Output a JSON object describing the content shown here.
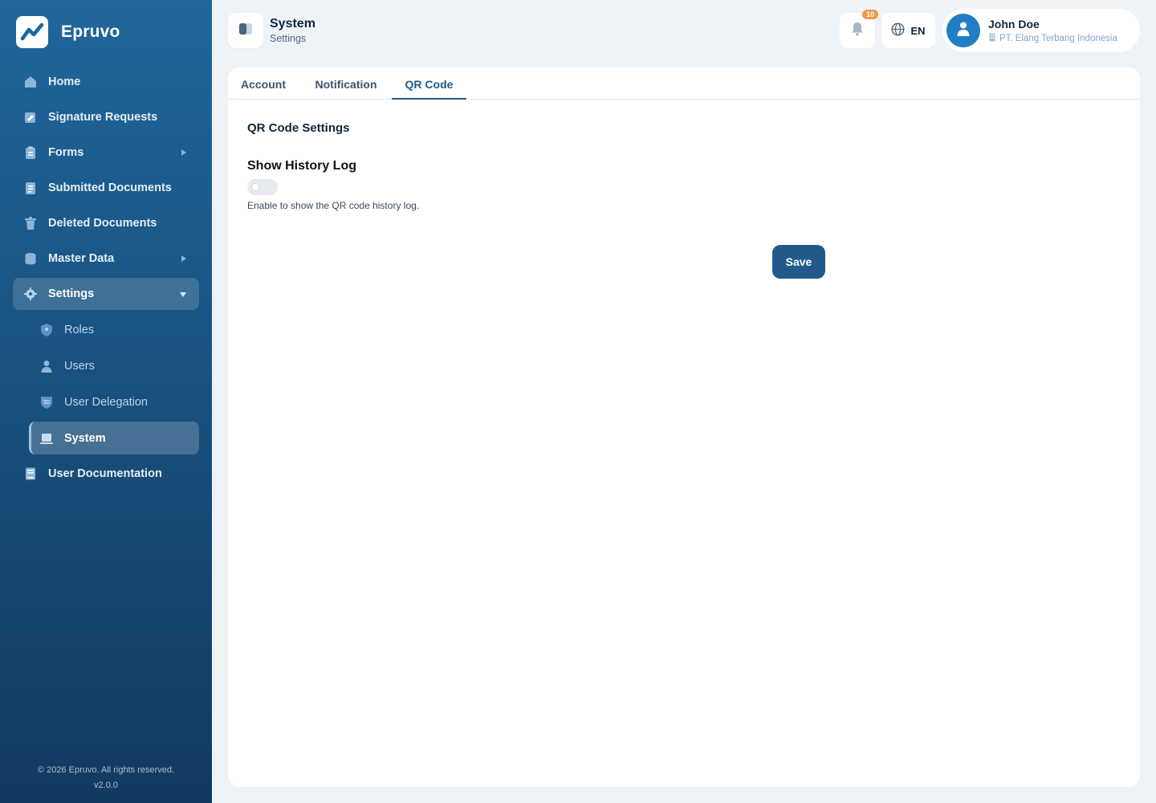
{
  "brand": {
    "name": "Epruvo"
  },
  "sidebar": {
    "items": [
      {
        "label": "Home",
        "icon": "home-icon"
      },
      {
        "label": "Signature Requests",
        "icon": "signature-icon"
      },
      {
        "label": "Forms",
        "icon": "clipboard-icon",
        "has_arrow": true
      },
      {
        "label": "Submitted Documents",
        "icon": "document-icon"
      },
      {
        "label": "Deleted Documents",
        "icon": "trash-icon"
      },
      {
        "label": "Master Data",
        "icon": "database-icon",
        "has_arrow": true
      },
      {
        "label": "Settings",
        "icon": "gear-icon",
        "expanded": true
      }
    ],
    "sub_items": [
      {
        "label": "Roles",
        "icon": "shield-icon"
      },
      {
        "label": "Users",
        "icon": "user-icon"
      },
      {
        "label": "User Delegation",
        "icon": "delegation-icon"
      },
      {
        "label": "System",
        "icon": "laptop-icon",
        "selected": true
      }
    ],
    "bottom_item": {
      "label": "User Documentation",
      "icon": "book-icon"
    }
  },
  "footer": {
    "copyright": "© 2026 Epruvo. All rights reserved.",
    "version": "v2.0.0"
  },
  "header": {
    "title": "System",
    "subtitle": "Settings",
    "notification_count": "10",
    "language": "EN",
    "user_name": "John Doe",
    "user_org": "PT. Elang Terbang Indonesia"
  },
  "tabs": [
    {
      "label": "Account"
    },
    {
      "label": "Notification"
    },
    {
      "label": "QR Code",
      "active": true
    }
  ],
  "qr": {
    "section_title": "QR Code Settings",
    "field_label": "Show History Log",
    "toggle_on": false,
    "helper": "Enable to show the QR code history log."
  },
  "actions": {
    "save_label": "Save"
  },
  "colors": {
    "accent": "#1f5a8b",
    "sidebar_top": "#20679c",
    "sidebar_bottom": "#123a60",
    "badge": "#f39a45"
  }
}
